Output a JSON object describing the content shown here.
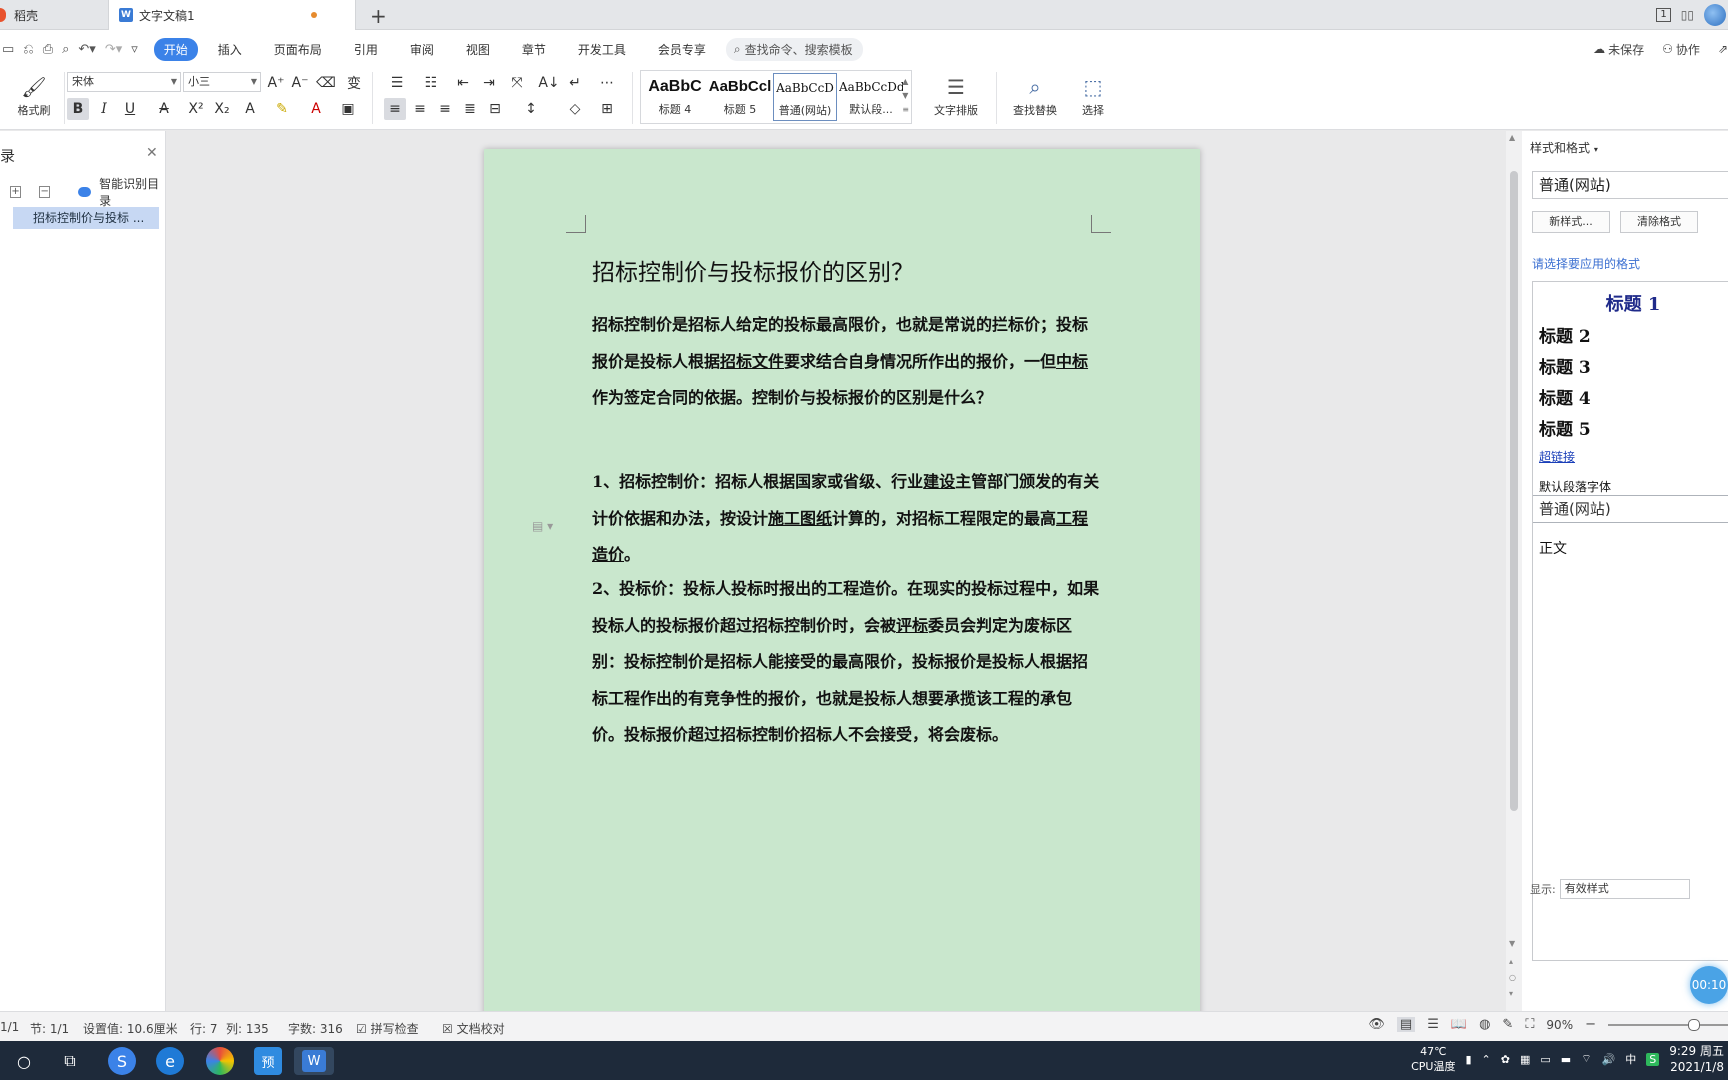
{
  "tabs": {
    "home_tab": "稻壳",
    "doc_tab": "文字文稿1",
    "doc_icon": "W",
    "window_badge": "1"
  },
  "menu": {
    "items": [
      "开始",
      "插入",
      "页面布局",
      "引用",
      "审阅",
      "视图",
      "章节",
      "开发工具",
      "会员专享"
    ],
    "search_placeholder": "查找命令、搜索模板",
    "unsaved": "未保存",
    "collab": "协作"
  },
  "ribbon": {
    "format_painter": "格式刷",
    "font_name": "宋体",
    "font_size": "小三",
    "styles": [
      {
        "preview": "AaBbC",
        "label": "标题 4"
      },
      {
        "preview": "AaBbCcl",
        "label": "标题 5"
      },
      {
        "preview": "AaBbCcD",
        "label": "普通(网站)"
      },
      {
        "preview": "AaBbCcDd",
        "label": "默认段..."
      }
    ],
    "text_layout": "文字排版",
    "find_replace": "查找替换",
    "select": "选择"
  },
  "nav": {
    "smart_toc": "智能识别目录",
    "item": "招标控制价与投标 ..."
  },
  "document": {
    "title": "招标控制价与投标报价的区别？",
    "p1_a": "招标控制价是招标人给定的投标最高限价，也就是常说的拦标价；投标报价是投标人根据",
    "p1_link1": "招标文件",
    "p1_b": "要求结合自身情况所作出的报价，一但",
    "p1_link2": "中标",
    "p1_c": "作为签定合同的依据。控制价与投标报价的区别是什么？",
    "p2_a": "1、招标控制价：招标人根据国家或省级、行业",
    "p2_link1": "建设",
    "p2_b": "主管部门颁发的有关计价依据和办法，按设计",
    "p2_link2": "施工图纸",
    "p2_c": "计算的，对招标工程限定的最高",
    "p2_link3": "工程造价",
    "p2_d": "。",
    "p3_a": "2、投标价：投标人投标时报出的工程造价。在现实的投标过程中，如果投标人的投标报价超过招标控制价时，会被",
    "p3_link1": "评标",
    "p3_b": "委员会判定为废标区别：投标控制价是招标人能接受的最高限价，投标报价是投标人根据招标工程作出的有竞争性的报价，也就是投标人想要承揽该工程的承包价。投标报价超过招标控制价招标人不会接受，将会废标。"
  },
  "styles_pane": {
    "header": "样式和格式",
    "current": "普通(网站)",
    "new_style": "新样式...",
    "clear_format": "清除格式",
    "hint": "请选择要应用的格式",
    "list": {
      "h1": "标题 1",
      "h2": "标题 2",
      "h3": "标题 3",
      "h4": "标题 4",
      "h5": "标题 5",
      "hyperlink": "超链接",
      "default_font": "默认段落字体",
      "web_normal": "普通(网站)",
      "body": "正文"
    },
    "show_label": "显示:",
    "show_value": "有效样式",
    "timer": "00:10"
  },
  "status": {
    "page": "1/1",
    "section": "节: 1/1",
    "setting": "设置值: 10.6厘米",
    "line": "行: 7",
    "column": "列: 135",
    "word_count": "字数: 316",
    "spell_check": "拼写检查",
    "doc_proof": "文档校对",
    "zoom": "90%"
  },
  "taskbar": {
    "temp": "47℃",
    "temp_label": "CPU温度",
    "time": "9:29 周五",
    "date": "2021/1/8"
  }
}
